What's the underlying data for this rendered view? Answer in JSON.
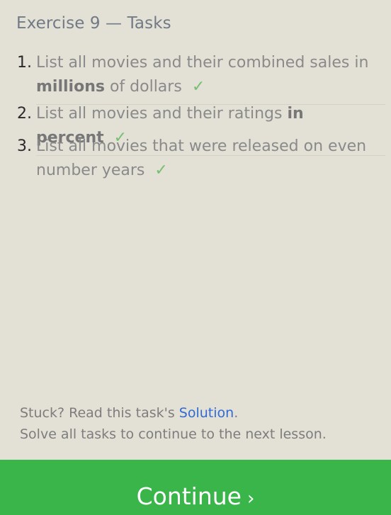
{
  "header": {
    "title": "Exercise 9 — Tasks"
  },
  "tasks": [
    {
      "number": "1.",
      "text_before": "List all movies and their combined sales in ",
      "bold": "millions",
      "text_after": " of dollars",
      "check": "✓"
    },
    {
      "number": "2.",
      "text_before": "List all movies and their ratings ",
      "bold": "in percent",
      "text_after": "",
      "check": "✓"
    },
    {
      "number": "3.",
      "text_before": "List all movies that were released on even number years",
      "bold": "",
      "text_after": "",
      "check": "✓"
    }
  ],
  "footer": {
    "stuck_text": "Stuck? Read this task's ",
    "solution_link": "Solution",
    "stuck_suffix": ".",
    "solve_text": "Solve all tasks to continue to the next lesson."
  },
  "continue_button": {
    "label": "Continue",
    "arrow": "›"
  },
  "colors": {
    "background": "#e3e0d6",
    "accent_green": "#3ab54a",
    "check_green": "#76bf72",
    "link_blue": "#2f6bd6"
  }
}
